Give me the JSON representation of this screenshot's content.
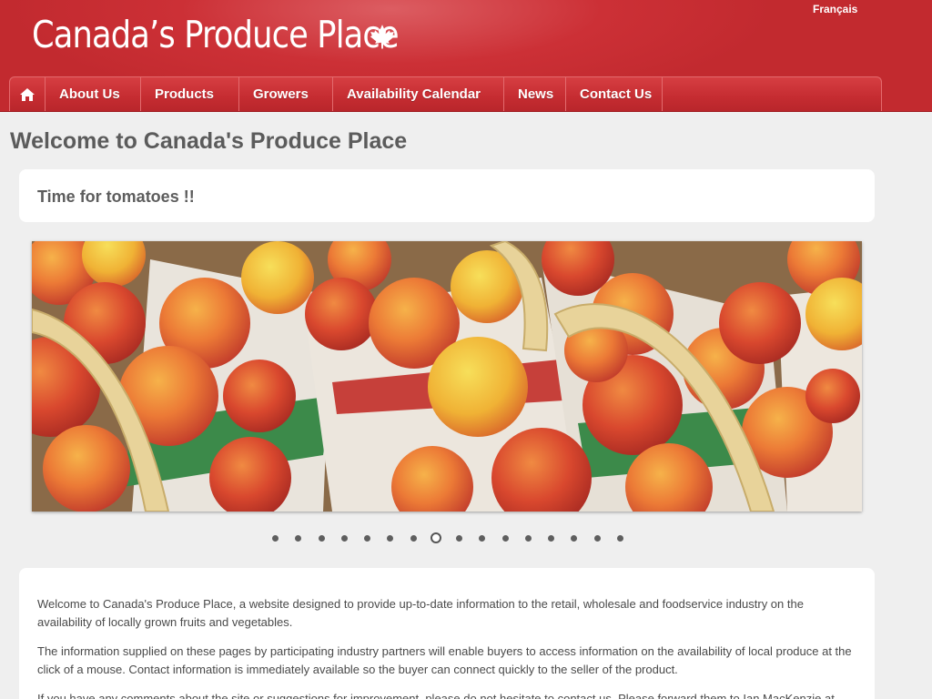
{
  "header": {
    "site_title": "Canada’s Produce Place",
    "language_link": "Français"
  },
  "nav": {
    "items": [
      {
        "label": "About Us"
      },
      {
        "label": "Products"
      },
      {
        "label": "Growers"
      },
      {
        "label": "Availability Calendar"
      },
      {
        "label": "News"
      },
      {
        "label": "Contact Us"
      }
    ]
  },
  "main": {
    "page_title": "Welcome to Canada's Produce Place",
    "notice": "Time for tomatoes !!",
    "slider": {
      "image_desc": "baskets of peaches",
      "dot_count": 16,
      "active_index": 7
    },
    "paragraphs": [
      "Welcome to Canada's Produce Place, a website designed to provide up-to-date information to the retail, wholesale and foodservice industry on the availability of locally grown fruits and vegetables.",
      "The information supplied on these pages by participating industry partners will enable buyers to access information on the availability of local produce at the click of a mouse. Contact information is immediately available so the buyer can connect quickly to the seller of the product.",
      "If you have any comments about the site or suggestions for improvement, please do not hesitate to contact us. Please forward them to Ian MacKenzie at"
    ]
  },
  "colors": {
    "header_red": "#c9292e",
    "nav_red": "#c52c31",
    "page_bg": "#efefef"
  },
  "icons": {
    "home": "home-icon",
    "maple": "maple-leaf-icon"
  }
}
